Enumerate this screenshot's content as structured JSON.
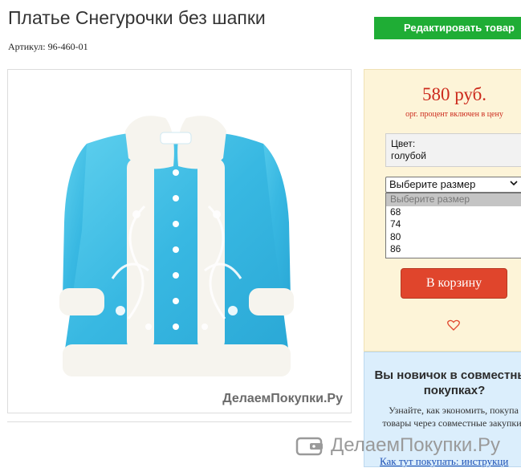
{
  "product": {
    "title": "Платье Снегурочки без шапки",
    "article": "Артикул: 96-460-01",
    "edit_button": "Редактировать товар",
    "watermark": "ДелаемПокупки.Ру"
  },
  "purchase": {
    "price": "580 руб.",
    "price_note": "орг. процент включен в цену",
    "color_label": "Цвет:",
    "color_value": "голубой",
    "size_select": {
      "selected": "Выберите размер",
      "options": [
        "Выберите размер",
        "68",
        "74",
        "80",
        "86"
      ]
    },
    "cart_button": "В корзину",
    "icons": {
      "favorite": "heart-icon"
    },
    "colors": {
      "price": "#cc2a1c",
      "cart": "#e0452c",
      "edit": "#1fad35"
    }
  },
  "newbie": {
    "title": "Вы новичок в совместных покупках?",
    "text": "Узнайте, как экономить, покупа товары через совместные закупки!",
    "link": "Как тут покупать: инструкци"
  },
  "bottom_watermark": {
    "text": "ДелаемПокупки.Ру",
    "icon": "wallet-icon"
  }
}
